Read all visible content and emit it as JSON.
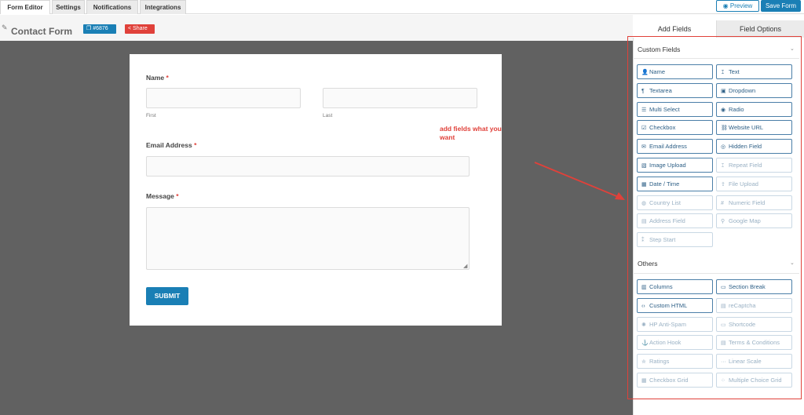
{
  "top_tabs": [
    "Form Editor",
    "Settings",
    "Notifications",
    "Integrations"
  ],
  "header_buttons": {
    "preview": "Preview",
    "save": "Save Form"
  },
  "form": {
    "title": "Contact Form",
    "id_badge": "#6876",
    "share_badge": "Share",
    "name_label": "Name",
    "required_mark": "*",
    "first_label": "First",
    "last_label": "Last",
    "email_label": "Email Address",
    "message_label": "Message",
    "submit_label": "SUBMIT"
  },
  "annotation": {
    "text": "add fields what you want",
    "color": "#e0413a"
  },
  "panel": {
    "tabs": [
      "Add Fields",
      "Field Options"
    ],
    "custom_section": "Custom Fields",
    "others_section": "Others"
  },
  "custom_fields": [
    {
      "label": "Name",
      "icon": "user-icon",
      "glyph": "👤",
      "enabled": true
    },
    {
      "label": "Text",
      "icon": "text-cursor-icon",
      "glyph": "𝙸",
      "enabled": true
    },
    {
      "label": "Textarea",
      "icon": "paragraph-icon",
      "glyph": "¶",
      "enabled": true
    },
    {
      "label": "Dropdown",
      "icon": "dropdown-icon",
      "glyph": "▣",
      "enabled": true
    },
    {
      "label": "Multi Select",
      "icon": "list-icon",
      "glyph": "☰",
      "enabled": true
    },
    {
      "label": "Radio",
      "icon": "radio-icon",
      "glyph": "◉",
      "enabled": true
    },
    {
      "label": "Checkbox",
      "icon": "checkbox-icon",
      "glyph": "☑",
      "enabled": true
    },
    {
      "label": "Website URL",
      "icon": "link-icon",
      "glyph": "⛓",
      "enabled": true
    },
    {
      "label": "Email Address",
      "icon": "envelope-icon",
      "glyph": "✉",
      "enabled": true
    },
    {
      "label": "Hidden Field",
      "icon": "eye-slash-icon",
      "glyph": "◎",
      "enabled": true
    },
    {
      "label": "Image Upload",
      "icon": "image-icon",
      "glyph": "▧",
      "enabled": true
    },
    {
      "label": "Repeat Field",
      "icon": "text-cursor-icon",
      "glyph": "𝙸",
      "enabled": false
    },
    {
      "label": "Date / Time",
      "icon": "calendar-icon",
      "glyph": "▦",
      "enabled": true
    },
    {
      "label": "File Upload",
      "icon": "upload-icon",
      "glyph": "⇪",
      "enabled": false
    },
    {
      "label": "Country List",
      "icon": "globe-icon",
      "glyph": "◍",
      "enabled": false
    },
    {
      "label": "Numeric Field",
      "icon": "hash-icon",
      "glyph": "#",
      "enabled": false
    },
    {
      "label": "Address Field",
      "icon": "address-card-icon",
      "glyph": "▤",
      "enabled": false
    },
    {
      "label": "Google Map",
      "icon": "map-pin-icon",
      "glyph": "⚲",
      "enabled": false
    },
    {
      "label": "Step Start",
      "icon": "step-icon",
      "glyph": "⁑",
      "enabled": false
    }
  ],
  "other_fields": [
    {
      "label": "Columns",
      "icon": "columns-icon",
      "glyph": "▥",
      "enabled": true
    },
    {
      "label": "Section Break",
      "icon": "section-break-icon",
      "glyph": "▭",
      "enabled": true
    },
    {
      "label": "Custom HTML",
      "icon": "code-icon",
      "glyph": "‹›",
      "enabled": true
    },
    {
      "label": "reCaptcha",
      "icon": "recaptcha-icon",
      "glyph": "▤",
      "enabled": false
    },
    {
      "label": "HP Anti-Spam",
      "icon": "honeypot-icon",
      "glyph": "✺",
      "enabled": false
    },
    {
      "label": "Shortcode",
      "icon": "shortcode-icon",
      "glyph": "▭",
      "enabled": false
    },
    {
      "label": "Action Hook",
      "icon": "anchor-icon",
      "glyph": "⚓",
      "enabled": false
    },
    {
      "label": "Terms & Conditions",
      "icon": "document-icon",
      "glyph": "▤",
      "enabled": false
    },
    {
      "label": "Ratings",
      "icon": "star-icon",
      "glyph": "✮",
      "enabled": false
    },
    {
      "label": "Linear Scale",
      "icon": "dots-icon",
      "glyph": "···",
      "enabled": false
    },
    {
      "label": "Checkbox Grid",
      "icon": "grid-icon",
      "glyph": "▦",
      "enabled": false
    },
    {
      "label": "Multiple Choice Grid",
      "icon": "grid-dots-icon",
      "glyph": "⁘",
      "enabled": false
    }
  ]
}
